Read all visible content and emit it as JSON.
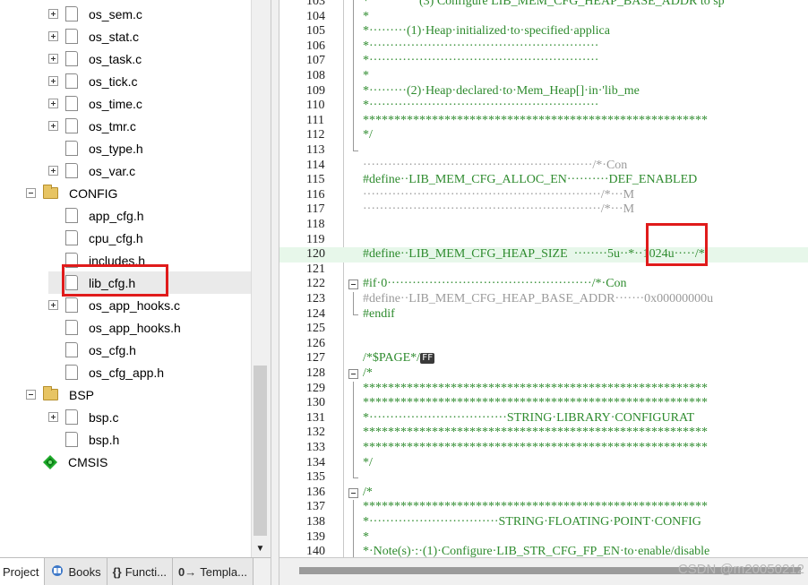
{
  "project_tree": {
    "items": [
      {
        "label": "os_sem.c",
        "type": "file",
        "expander": "plus"
      },
      {
        "label": "os_stat.c",
        "type": "file",
        "expander": "plus"
      },
      {
        "label": "os_task.c",
        "type": "file",
        "expander": "plus"
      },
      {
        "label": "os_tick.c",
        "type": "file",
        "expander": "plus"
      },
      {
        "label": "os_time.c",
        "type": "file",
        "expander": "plus"
      },
      {
        "label": "os_tmr.c",
        "type": "file",
        "expander": "plus"
      },
      {
        "label": "os_type.h",
        "type": "file",
        "expander": "none"
      },
      {
        "label": "os_var.c",
        "type": "file",
        "expander": "plus"
      },
      {
        "label": "CONFIG",
        "type": "folder",
        "expander": "minus"
      },
      {
        "label": "app_cfg.h",
        "type": "file",
        "expander": "none"
      },
      {
        "label": "cpu_cfg.h",
        "type": "file",
        "expander": "none"
      },
      {
        "label": "includes.h",
        "type": "file",
        "expander": "none"
      },
      {
        "label": "lib_cfg.h",
        "type": "file",
        "expander": "none",
        "selected": true
      },
      {
        "label": "os_app_hooks.c",
        "type": "file",
        "expander": "plus"
      },
      {
        "label": "os_app_hooks.h",
        "type": "file",
        "expander": "none"
      },
      {
        "label": "os_cfg.h",
        "type": "file",
        "expander": "none"
      },
      {
        "label": "os_cfg_app.h",
        "type": "file",
        "expander": "none"
      },
      {
        "label": "BSP",
        "type": "folder",
        "expander": "minus"
      },
      {
        "label": "bsp.c",
        "type": "file",
        "expander": "plus"
      },
      {
        "label": "bsp.h",
        "type": "file",
        "expander": "none"
      },
      {
        "label": "CMSIS",
        "type": "component",
        "expander": "none"
      }
    ]
  },
  "bottom_tabs": [
    {
      "label": "Project",
      "icon": "",
      "active": true
    },
    {
      "label": "Books",
      "icon": "books-icon",
      "active": false
    },
    {
      "label": "Functi...",
      "icon": "{}",
      "active": false
    },
    {
      "label": "Templa...",
      "icon": "0→",
      "active": false
    }
  ],
  "editor": {
    "lines": [
      {
        "n": "103",
        "text": "*                (3) Configure LIB_MEM_CFG_HEAP_BASE_ADDR to sp",
        "fold": "line",
        "cls": ""
      },
      {
        "n": "104",
        "text": "*",
        "fold": "line",
        "cls": ""
      },
      {
        "n": "105",
        "text": "*·········(1)·Heap·initialized·to·specified·applica",
        "fold": "line",
        "cls": ""
      },
      {
        "n": "106",
        "text": "*·······················································",
        "fold": "line",
        "cls": ""
      },
      {
        "n": "107",
        "text": "*·······················································",
        "fold": "line",
        "cls": ""
      },
      {
        "n": "108",
        "text": "*",
        "fold": "line",
        "cls": ""
      },
      {
        "n": "109",
        "text": "*·········(2)·Heap·declared·to·Mem_Heap[]·in·'lib_me",
        "fold": "line",
        "cls": ""
      },
      {
        "n": "110",
        "text": "*·······················································",
        "fold": "line",
        "cls": ""
      },
      {
        "n": "111",
        "text": "*******************************************************",
        "fold": "line",
        "cls": ""
      },
      {
        "n": "112",
        "text": "*/",
        "fold": "line",
        "cls": ""
      },
      {
        "n": "113",
        "text": "",
        "fold": "end",
        "cls": ""
      },
      {
        "n": "114",
        "text": "·······················································/*·Con",
        "fold": "",
        "cls": "gray"
      },
      {
        "n": "115",
        "text": "#define··LIB_MEM_CFG_ALLOC_EN··········DEF_ENABLED",
        "fold": "",
        "cls": "pp"
      },
      {
        "n": "116",
        "text": "·························································/*···M",
        "fold": "",
        "cls": "gray"
      },
      {
        "n": "117",
        "text": "·························································/*···M",
        "fold": "",
        "cls": "gray"
      },
      {
        "n": "118",
        "text": "",
        "fold": "",
        "cls": ""
      },
      {
        "n": "119",
        "text": "",
        "fold": "",
        "cls": ""
      },
      {
        "n": "120",
        "text": "#define··LIB_MEM_CFG_HEAP_SIZE  ········5u··*··1024u·····/*",
        "fold": "",
        "cls": "pp",
        "highlight": true
      },
      {
        "n": "121",
        "text": "",
        "fold": "",
        "cls": ""
      },
      {
        "n": "122",
        "text": "#if·0·················································/*·Con",
        "fold": "box",
        "cls": "pp"
      },
      {
        "n": "123",
        "text": "#define··LIB_MEM_CFG_HEAP_BASE_ADDR·······0x00000000u",
        "fold": "line",
        "cls": "gray"
      },
      {
        "n": "124",
        "text": "#endif",
        "fold": "end",
        "cls": "pp"
      },
      {
        "n": "125",
        "text": "",
        "fold": "",
        "cls": ""
      },
      {
        "n": "126",
        "text": "",
        "fold": "",
        "cls": ""
      },
      {
        "n": "127",
        "text": "/*$PAGE*/",
        "fold": "",
        "cls": "",
        "ff": "FF"
      },
      {
        "n": "128",
        "text": "/*",
        "fold": "box",
        "cls": ""
      },
      {
        "n": "129",
        "text": "*******************************************************",
        "fold": "line",
        "cls": ""
      },
      {
        "n": "130",
        "text": "*******************************************************",
        "fold": "line",
        "cls": ""
      },
      {
        "n": "131",
        "text": "*·································STRING·LIBRARY·CONFIGURAT",
        "fold": "line",
        "cls": ""
      },
      {
        "n": "132",
        "text": "*******************************************************",
        "fold": "line",
        "cls": ""
      },
      {
        "n": "133",
        "text": "*******************************************************",
        "fold": "line",
        "cls": ""
      },
      {
        "n": "134",
        "text": "*/",
        "fold": "line",
        "cls": ""
      },
      {
        "n": "135",
        "text": "",
        "fold": "end",
        "cls": ""
      },
      {
        "n": "136",
        "text": "/*",
        "fold": "box",
        "cls": ""
      },
      {
        "n": "137",
        "text": "*******************************************************",
        "fold": "line",
        "cls": ""
      },
      {
        "n": "138",
        "text": "*·······························STRING·FLOATING·POINT·CONFIG",
        "fold": "line",
        "cls": ""
      },
      {
        "n": "139",
        "text": "*",
        "fold": "line",
        "cls": ""
      },
      {
        "n": "140",
        "text": "*·Note(s)·:·(1)·Configure·LIB_STR_CFG_FP_EN·to·enable/disable",
        "fold": "line",
        "cls": ""
      },
      {
        "n": "141",
        "text": "*",
        "fold": "line",
        "cls": ""
      }
    ]
  },
  "watermark": "CSDN @m20050212",
  "colors": {
    "annotation_red": "#e01b1b",
    "comment_green": "#2e8b2e",
    "line_highlight": "#e7f7ea"
  }
}
